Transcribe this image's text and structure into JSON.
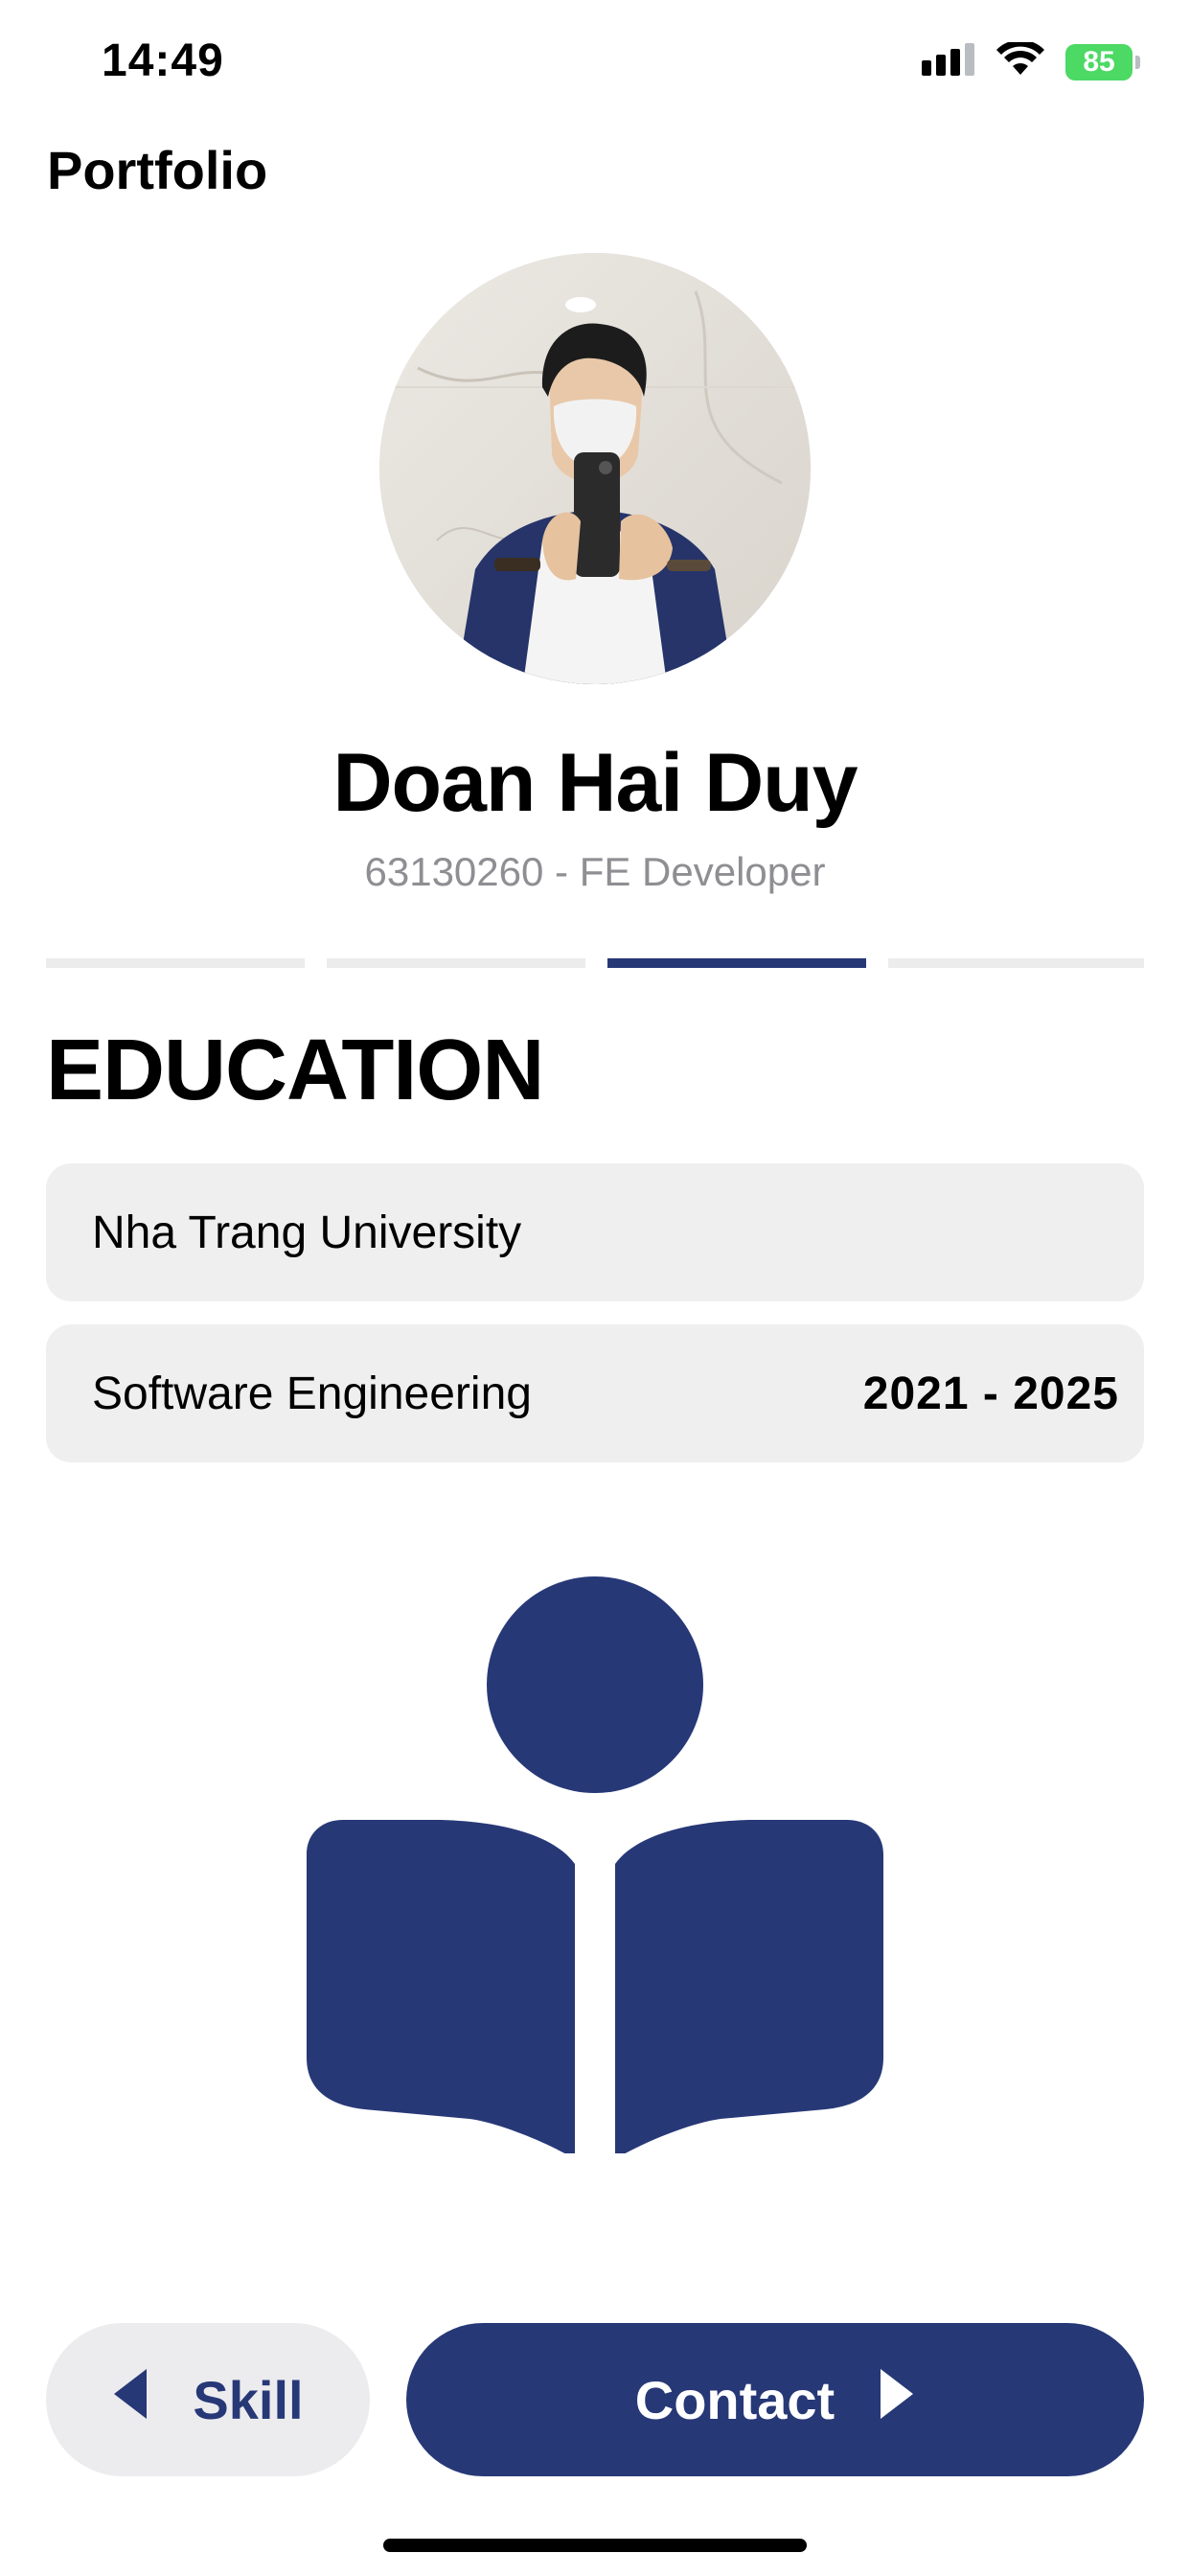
{
  "status_bar": {
    "time": "14:49",
    "battery": "85"
  },
  "nav": {
    "title": "Portfolio"
  },
  "profile": {
    "name": "Doan Hai Duy",
    "subtitle": "63130260 - FE Developer"
  },
  "progress": {
    "total_steps": 4,
    "current_step": 3,
    "active_color": "#273877",
    "inactive_color": "#ececec"
  },
  "education": {
    "title": "EDUCATION",
    "school": "Nha Trang University",
    "major": "Software Engineering",
    "years": "2021 - 2025",
    "icon": "reading-person-icon"
  },
  "buttons": {
    "back_label": "Skill",
    "next_label": "Contact"
  },
  "colors": {
    "accent": "#273877",
    "card_bg": "#efefef",
    "muted_text": "#8e8e93"
  }
}
